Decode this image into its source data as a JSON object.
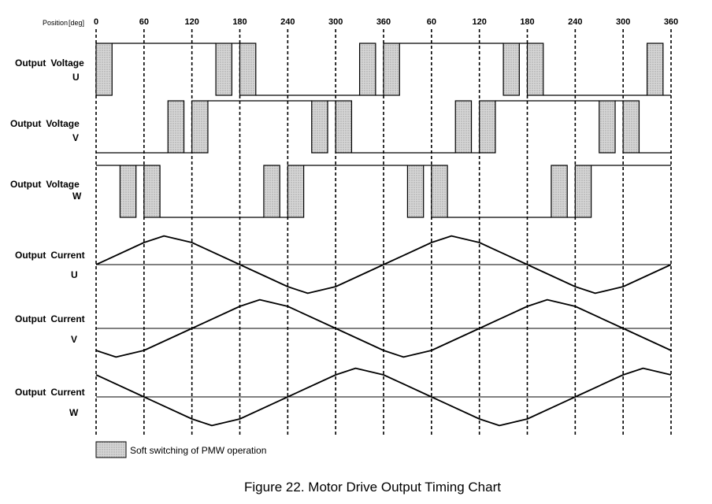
{
  "position_label": "Position",
  "position_unit": "[deg]",
  "ticks": [
    "0",
    "60",
    "120",
    "180",
    "240",
    "300",
    "360",
    "60",
    "120",
    "180",
    "240",
    "300",
    "360"
  ],
  "signals": [
    {
      "id": "voltage-u",
      "word1": "Output",
      "word2": "Voltage",
      "phase": "U"
    },
    {
      "id": "voltage-v",
      "word1": "Output",
      "word2": "Voltage",
      "phase": "V"
    },
    {
      "id": "voltage-w",
      "word1": "Output",
      "word2": "Voltage",
      "phase": "W"
    },
    {
      "id": "current-u",
      "word1": "Output",
      "word2": "Current",
      "phase": "U"
    },
    {
      "id": "current-v",
      "word1": "Output",
      "word2": "Current",
      "phase": "V"
    },
    {
      "id": "current-w",
      "word1": "Output",
      "word2": "Current",
      "phase": "W"
    }
  ],
  "legend": {
    "label": "Soft switching of PMW operation"
  },
  "caption": "Figure 22. Motor Drive Output Timing Chart",
  "colors": {
    "line": "#000000",
    "hatch_fill": "#d6d6d6",
    "hatch_dot": "#8a8a8a"
  },
  "chart_data": {
    "type": "timing",
    "x_unit": "deg",
    "x_range": [
      0,
      720
    ],
    "voltages": {
      "U": {
        "high_from": 0,
        "high_to": 180,
        "soft_switching": [
          [
            0,
            20
          ],
          [
            150,
            170
          ],
          [
            180,
            200
          ],
          [
            330,
            350
          ]
        ]
      },
      "V": {
        "high_from": 120,
        "high_to": 300,
        "soft_switching": [
          [
            90,
            110
          ],
          [
            120,
            140
          ],
          [
            270,
            290
          ],
          [
            300,
            320
          ]
        ]
      },
      "W": {
        "high_from": 240,
        "high_to": 420,
        "soft_switching": [
          [
            30,
            50
          ],
          [
            60,
            80
          ],
          [
            210,
            230
          ],
          [
            240,
            260
          ]
        ]
      }
    },
    "currents": {
      "U": {
        "points": [
          [
            0,
            0
          ],
          [
            60,
            1
          ],
          [
            85,
            1.3
          ],
          [
            120,
            1
          ],
          [
            180,
            0
          ],
          [
            240,
            -1
          ],
          [
            265,
            -1.3
          ],
          [
            300,
            -1
          ],
          [
            360,
            0
          ]
        ]
      },
      "V": {
        "points": [
          [
            0,
            -1
          ],
          [
            25,
            -1.3
          ],
          [
            60,
            -1
          ],
          [
            120,
            0
          ],
          [
            180,
            1
          ],
          [
            205,
            1.3
          ],
          [
            240,
            1
          ],
          [
            300,
            0
          ],
          [
            360,
            -1
          ]
        ]
      },
      "W": {
        "points": [
          [
            0,
            1
          ],
          [
            60,
            0
          ],
          [
            120,
            -1
          ],
          [
            145,
            -1.3
          ],
          [
            180,
            -1
          ],
          [
            240,
            0
          ],
          [
            300,
            1
          ],
          [
            325,
            1.3
          ],
          [
            360,
            1
          ]
        ]
      }
    }
  }
}
